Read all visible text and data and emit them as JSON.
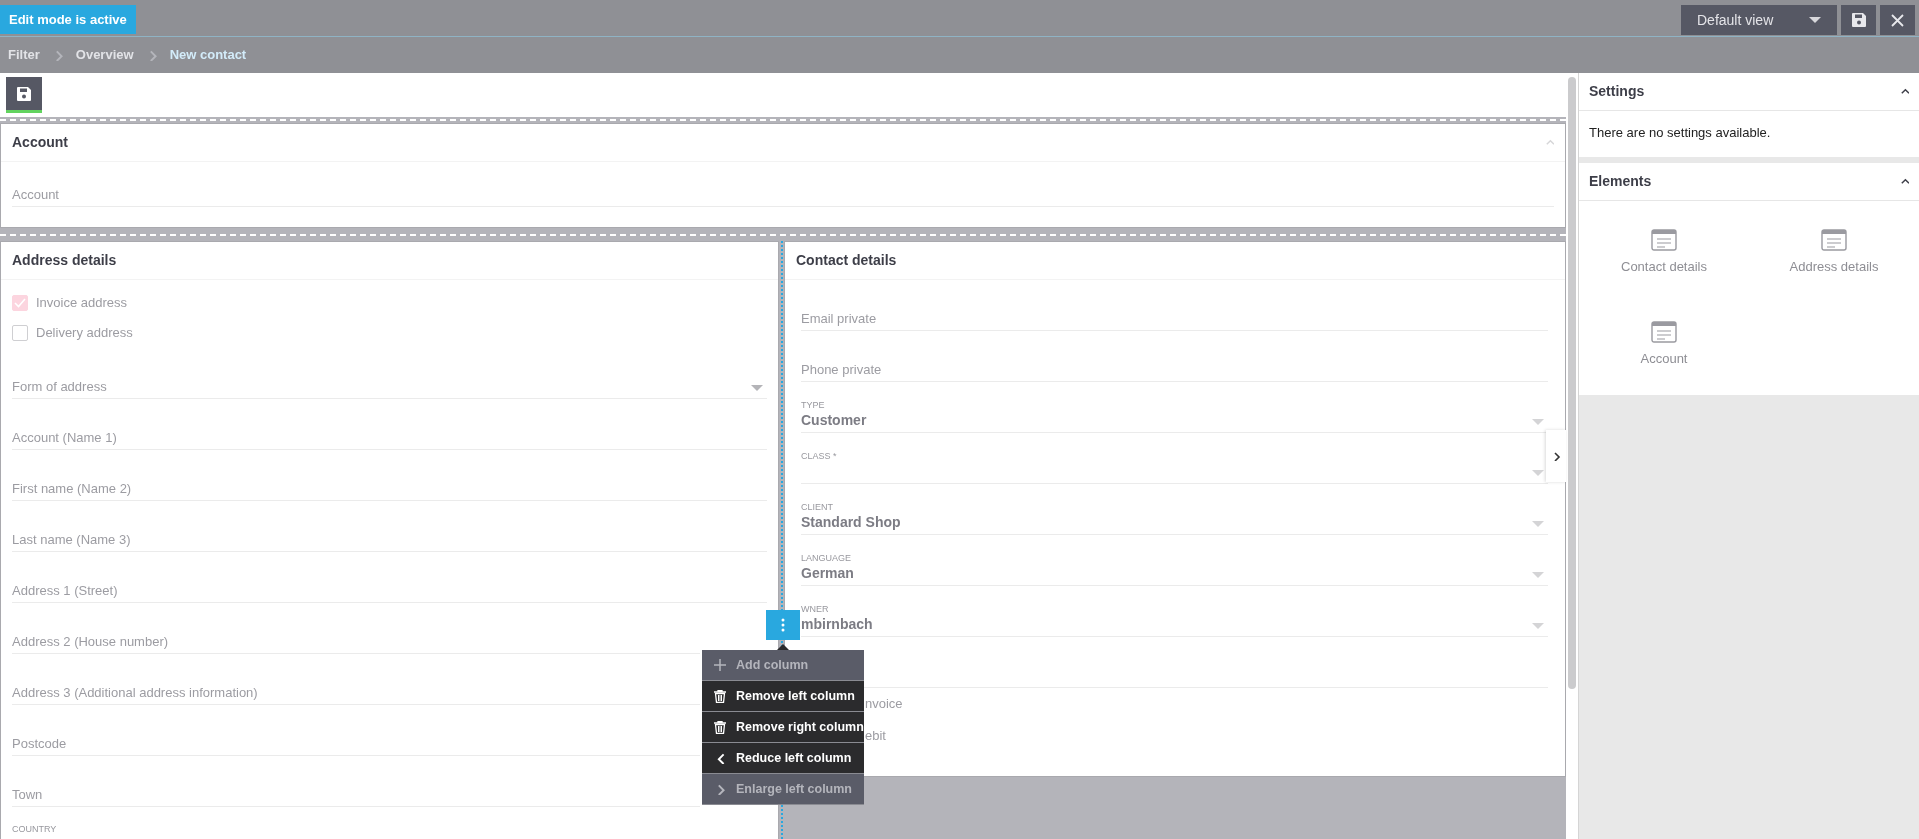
{
  "edit_badge": "Edit mode is active",
  "view_select": {
    "value": "Default view"
  },
  "breadcrumb": [
    {
      "label": "Filter",
      "current": false
    },
    {
      "label": "Overview",
      "current": false
    },
    {
      "label": "New contact",
      "current": true
    }
  ],
  "account_card": {
    "title": "Account",
    "expanded": true,
    "fields": [
      {
        "kind": "text",
        "placeholder": "Account"
      }
    ]
  },
  "address_card": {
    "title": "Address details",
    "checkboxes": [
      {
        "label": "Invoice address",
        "checked": true
      },
      {
        "label": "Delivery address",
        "checked": false
      }
    ],
    "fields": [
      {
        "kind": "select",
        "placeholder": "Form of address"
      },
      {
        "kind": "text",
        "placeholder": "Account (Name 1)"
      },
      {
        "kind": "text",
        "placeholder": "First name (Name 2)"
      },
      {
        "kind": "text",
        "placeholder": "Last name (Name 3)"
      },
      {
        "kind": "text",
        "placeholder": "Address 1 (Street)"
      },
      {
        "kind": "text",
        "placeholder": "Address 2 (House number)"
      },
      {
        "kind": "text",
        "placeholder": "Address 3 (Additional address information)"
      },
      {
        "kind": "text",
        "placeholder": "Postcode"
      },
      {
        "kind": "text",
        "placeholder": "Town"
      },
      {
        "kind": "caption",
        "label": "COUNTRY"
      }
    ]
  },
  "contact_card": {
    "title": "Contact details",
    "fields": [
      {
        "kind": "text",
        "placeholder": "Email private"
      },
      {
        "kind": "text",
        "placeholder": "Phone private"
      },
      {
        "kind": "select",
        "label": "TYPE",
        "value": "Customer"
      },
      {
        "kind": "select",
        "label": "CLASS *"
      },
      {
        "kind": "select",
        "label": "CLIENT",
        "value": "Standard Shop"
      },
      {
        "kind": "select",
        "label": "LANGUAGE",
        "value": "German"
      },
      {
        "kind": "select",
        "label": "WNER",
        "value": "mbirnbach"
      },
      {
        "kind": "text"
      }
    ],
    "checkbox_labels": [
      "nvoice",
      "ebit"
    ]
  },
  "column_menu": {
    "items": [
      {
        "kind": "add",
        "label": "Add column",
        "disabled": true
      },
      {
        "kind": "remove",
        "label": "Remove left column",
        "disabled": false
      },
      {
        "kind": "remove",
        "label": "Remove right column",
        "disabled": false
      },
      {
        "kind": "reduce",
        "label": "Reduce left column",
        "disabled": false
      },
      {
        "kind": "enlarge",
        "label": "Enlarge left column",
        "disabled": true
      }
    ]
  },
  "sidebar": {
    "settings": {
      "title": "Settings",
      "expanded": true,
      "message": "There are no settings available."
    },
    "elements": {
      "title": "Elements",
      "expanded": true,
      "items": [
        "Contact details",
        "Address details",
        "Account"
      ]
    }
  }
}
